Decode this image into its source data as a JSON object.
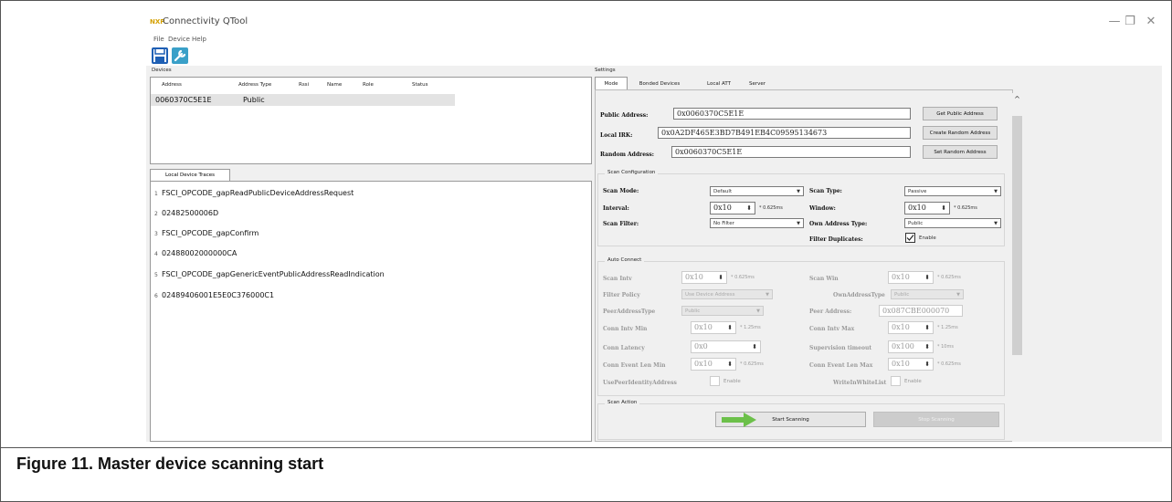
{
  "window": {
    "title": "Connectivity QTool",
    "logo": "NXP",
    "menu": [
      "File",
      "Device",
      "Help"
    ],
    "controls": {
      "minimize": "—",
      "maximize": "❐",
      "close": "✕"
    }
  },
  "devices": {
    "label": "Devices",
    "columns": [
      "Address",
      "Address Type",
      "Rssi",
      "Name",
      "Role",
      "Status"
    ],
    "row": {
      "address": "0060370C5E1E",
      "type": "Public"
    }
  },
  "traces": {
    "tab": "Local Device Traces",
    "lines": [
      {
        "n": "1",
        "text": "FSCI_OPCODE_gapReadPublicDeviceAddressRequest"
      },
      {
        "n": "2",
        "text": "02482500006D"
      },
      {
        "n": "3",
        "text": "FSCI_OPCODE_gapConfirm"
      },
      {
        "n": "4",
        "text": "02488002000000CA"
      },
      {
        "n": "5",
        "text": "FSCI_OPCODE_gapGenericEventPublicAddressReadIndication"
      },
      {
        "n": "6",
        "text": "02489406001E5E0C376000C1"
      }
    ]
  },
  "settings": {
    "label": "Settings",
    "tabs": [
      "Mode",
      "Bonded Devices",
      "Local ATT",
      "Server"
    ],
    "public_address": {
      "label": "Public Address:",
      "value": "0x0060370C5E1E",
      "button": "Get Public Address"
    },
    "local_irk": {
      "label": "Local IRK:",
      "value": "0x0A2DF465E3BD7B491EB4C09595134673",
      "button": "Create Random Address"
    },
    "random_address": {
      "label": "Random Address:",
      "value": "0x0060370C5E1E",
      "button": "Set Random Address"
    },
    "scan_config": {
      "title": "Scan Configuration",
      "scan_mode": {
        "label": "Scan Mode:",
        "value": "Default"
      },
      "scan_type": {
        "label": "Scan Type:",
        "value": "Passive"
      },
      "interval": {
        "label": "Interval:",
        "value": "0x10",
        "unit": "* 0.625ms"
      },
      "window": {
        "label": "Window:",
        "value": "0x10",
        "unit": "* 0.625ms"
      },
      "scan_filter": {
        "label": "Scan Filter:",
        "value": "No Filter"
      },
      "own_addr_type": {
        "label": "Own Address Type:",
        "value": "Public"
      },
      "filter_dup": {
        "label": "Filter Duplicates:",
        "check": "Enable"
      }
    },
    "auto_connect": {
      "title": "Auto Connect",
      "scan_intv": {
        "label": "Scan Intv",
        "value": "0x10",
        "unit": "* 0.625ms"
      },
      "scan_win": {
        "label": "Scan Win",
        "value": "0x10",
        "unit": "* 0.625ms"
      },
      "filter_policy": {
        "label": "Filter Policy",
        "value": "Use Device Address"
      },
      "own_addr_type": {
        "label": "OwnAddressType",
        "value": "Public"
      },
      "peer_addr_type": {
        "label": "PeerAddressType",
        "value": "Public"
      },
      "peer_address": {
        "label": "Peer Address:",
        "value": "0x087CBE000070"
      },
      "conn_intv_min": {
        "label": "Conn Intv Min",
        "value": "0x10",
        "unit": "* 1.25ms"
      },
      "conn_intv_max": {
        "label": "Conn Intv Max",
        "value": "0x10",
        "unit": "* 1.25ms"
      },
      "conn_latency": {
        "label": "Conn Latency",
        "value": "0x0"
      },
      "sup_timeout": {
        "label": "Supervision timeout",
        "value": "0x100",
        "unit": "* 10ms"
      },
      "ce_len_min": {
        "label": "Conn Event Len Min",
        "value": "0x10",
        "unit": "* 0.625ms"
      },
      "ce_len_max": {
        "label": "Conn Event Len Max",
        "value": "0x10",
        "unit": "* 0.625ms"
      },
      "use_peer_id": {
        "label": "UsePeerIdentityAddress",
        "check": "Enable"
      },
      "write_wl": {
        "label": "WriteInWhiteList",
        "check": "Enable"
      }
    },
    "scan_action": {
      "title": "Scan Action",
      "start": "Start Scanning",
      "stop": "Stop Scanning"
    },
    "scroll_up": "^"
  },
  "caption": "Figure 11.  Master device scanning start",
  "colors": {
    "accent_arrow": "#6cc04a",
    "save_icon": "#1e5fb4",
    "wrench_icon": "#3aa0c8"
  }
}
